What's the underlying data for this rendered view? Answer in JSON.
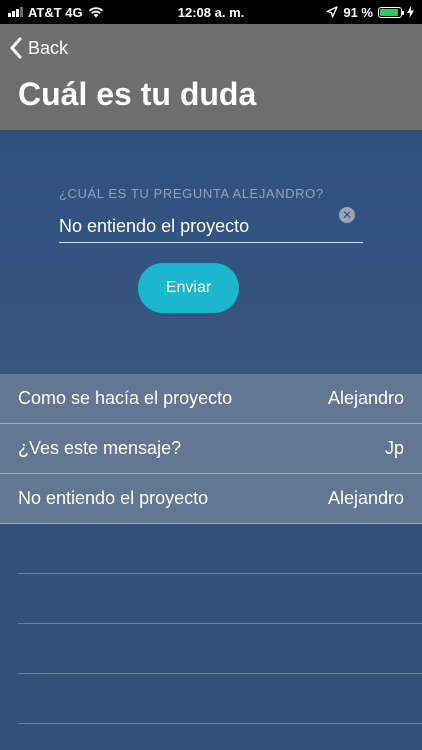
{
  "status_bar": {
    "carrier": "AT&T 4G",
    "time": "12:08 a. m.",
    "battery_percent": "91 %",
    "battery_level": 0.91,
    "battery_color": "#34c759"
  },
  "header": {
    "back_label": "Back",
    "title": "Cuál es tu duda"
  },
  "question_form": {
    "label": "¿CUÁL ES TU PREGUNTA ALEJANDRO?",
    "input_value": "No entiendo el proyecto",
    "send_label": "Enviar",
    "send_color": "#1cb7cf"
  },
  "questions": [
    {
      "text": "Como se hacía el proyecto",
      "author": "Alejandro"
    },
    {
      "text": "¿Ves este mensaje?",
      "author": "Jp"
    },
    {
      "text": "No entiendo el proyecto",
      "author": "Alejandro"
    }
  ],
  "colors": {
    "background": "#32517a",
    "header": "#6e6e6e"
  }
}
